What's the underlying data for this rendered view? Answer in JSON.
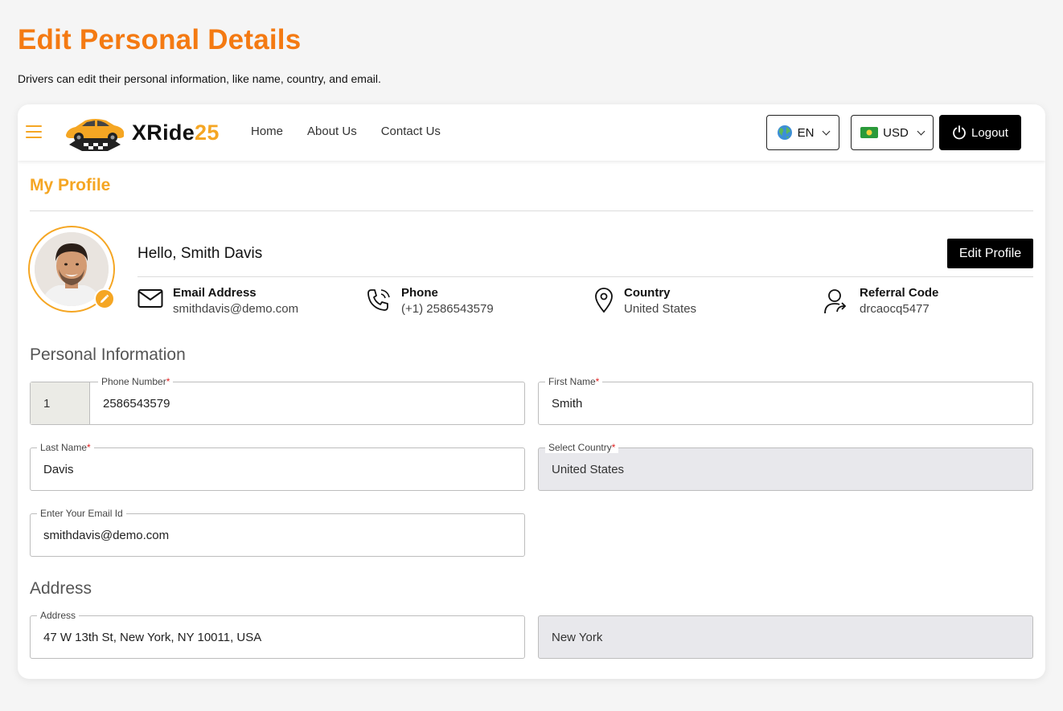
{
  "page": {
    "title": "Edit Personal Details",
    "subtitle": "Drivers can edit their personal information, like name, country, and email."
  },
  "nav": {
    "logo_text": "XRide",
    "logo_num": "25",
    "links": [
      "Home",
      "About Us",
      "Contact Us"
    ],
    "language": "EN",
    "currency": "USD",
    "logout": "Logout"
  },
  "profile": {
    "heading": "My Profile",
    "greeting": "Hello, Smith Davis",
    "edit_button": "Edit Profile",
    "email_title": "Email Address",
    "email_value": "smithdavis@demo.com",
    "phone_title": "Phone",
    "phone_value": "(+1) 2586543579",
    "country_title": "Country",
    "country_value": "United States",
    "referral_title": "Referral Code",
    "referral_value": "drcaocq5477"
  },
  "personal": {
    "section_title": "Personal Information",
    "phone_label": "Phone Number",
    "phone_code": "1",
    "phone_value": "2586543579",
    "first_name_label": "First Name",
    "first_name_value": "Smith",
    "last_name_label": "Last Name",
    "last_name_value": "Davis",
    "country_label": "Select Country",
    "country_value": "United States",
    "email_label": "Enter Your Email Id",
    "email_value": "smithdavis@demo.com",
    "required_mark": "*"
  },
  "address": {
    "section_title": "Address",
    "address_label": "Address",
    "address_value": "47 W 13th St, New York, NY 10011, USA",
    "city_value": "New York"
  },
  "colors": {
    "title_orange": "#f47a12",
    "accent": "#f5a623"
  }
}
